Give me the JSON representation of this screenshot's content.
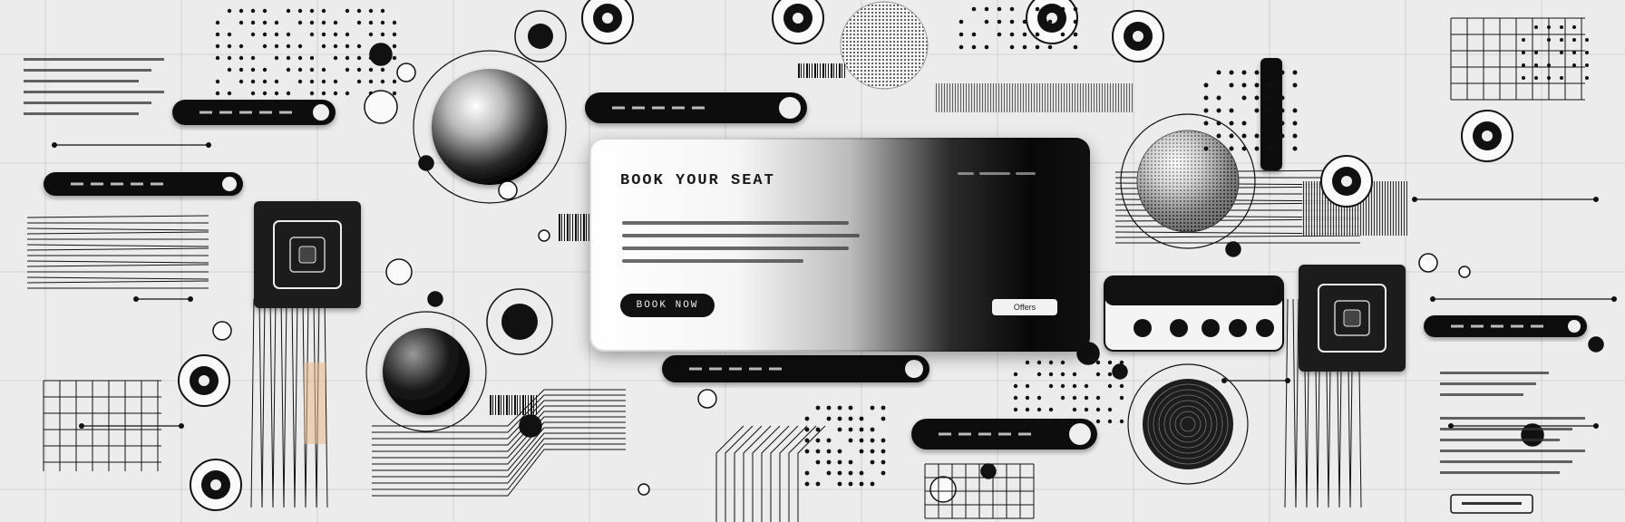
{
  "card": {
    "title": "BOOK YOUR SEAT",
    "button_label": "BOOK NOW",
    "badge_label": "Offers"
  },
  "colors": {
    "background": "#ececec",
    "ink": "#111111",
    "card_light": "#ffffff",
    "card_dark": "#080808"
  }
}
